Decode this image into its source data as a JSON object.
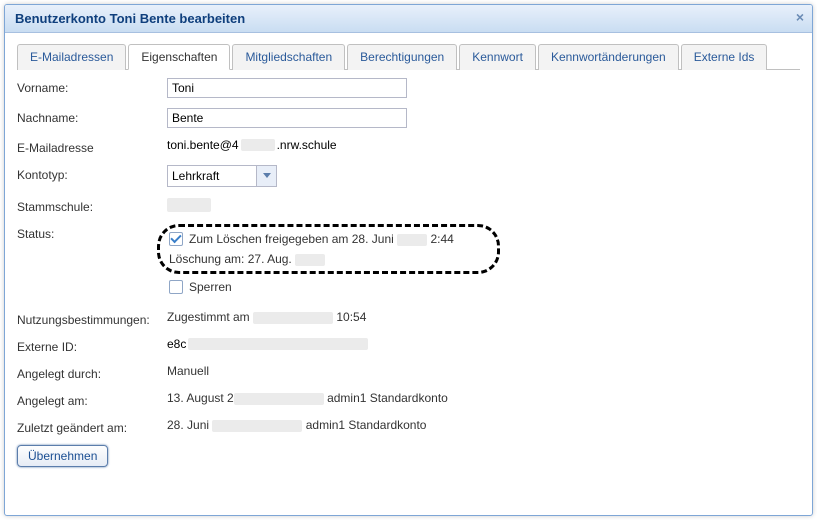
{
  "dialog": {
    "title": "Benutzerkonto Toni Bente bearbeiten"
  },
  "tabs": {
    "email": "E-Mailadressen",
    "properties": "Eigenschaften",
    "memberships": "Mitgliedschaften",
    "permissions": "Berechtigungen",
    "password": "Kennwort",
    "pwchanges": "Kennwortänderungen",
    "externalids": "Externe Ids"
  },
  "labels": {
    "firstname": "Vorname:",
    "lastname": "Nachname:",
    "email": "E-Mailadresse",
    "accounttype": "Kontotyp:",
    "mainschool": "Stammschule:",
    "status": "Status:",
    "terms": "Nutzungsbestimmungen:",
    "externalid": "Externe ID:",
    "createdby": "Angelegt durch:",
    "createdon": "Angelegt am:",
    "lastmodified": "Zuletzt geändert am:"
  },
  "values": {
    "firstname": "Toni",
    "lastname": "Bente",
    "email_prefix": "toni.bente@4",
    "email_suffix": ".nrw.schule",
    "accounttype": "Lehrkraft",
    "status_delete_prefix": "Zum Löschen freigegeben am 28. Juni",
    "status_delete_suffix": "2:44",
    "status_deletion_on": "Löschung am: 27. Aug.",
    "status_lock": "Sperren",
    "terms_prefix": "Zugestimmt am",
    "terms_suffix": "10:54",
    "externalid_prefix": "e8c",
    "createdby": "Manuell",
    "createdon_prefix": "13. August 2",
    "createdon_suffix": "admin1 Standardkonto",
    "lastmod_prefix": "28. Juni",
    "lastmod_suffix": "admin1 Standardkonto"
  },
  "buttons": {
    "submit": "Übernehmen"
  }
}
